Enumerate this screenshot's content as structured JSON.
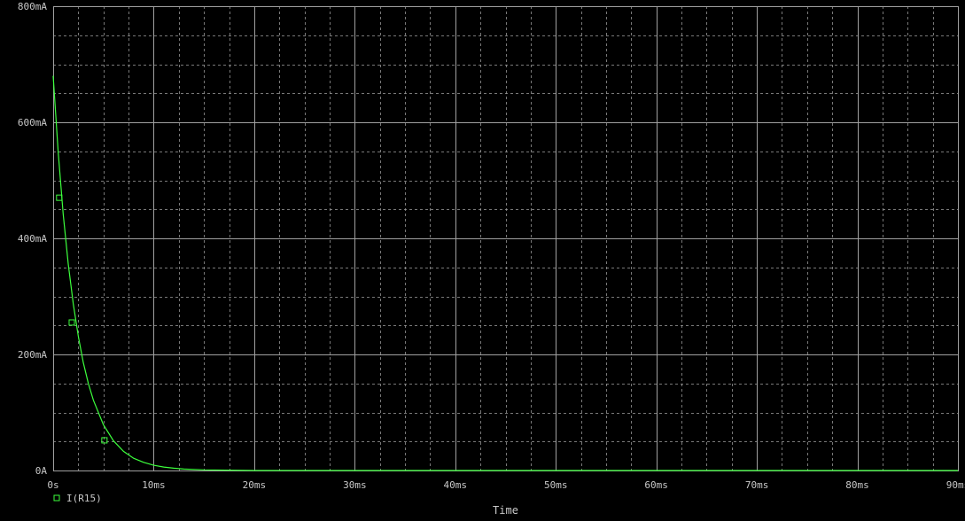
{
  "colors": {
    "background": "#000000",
    "grid": "#a0a0a0",
    "axis_text": "#c8c8c8",
    "trace": "#3cff3c"
  },
  "chart_data": {
    "type": "line",
    "xlabel": "Time",
    "ylabel": "",
    "x_unit": "ms",
    "y_unit": "mA",
    "xlim": [
      0,
      90
    ],
    "ylim": [
      0,
      800
    ],
    "x_ticks": [
      {
        "value": 0,
        "label": "0s"
      },
      {
        "value": 10,
        "label": "10ms"
      },
      {
        "value": 20,
        "label": "20ms"
      },
      {
        "value": 30,
        "label": "30ms"
      },
      {
        "value": 40,
        "label": "40ms"
      },
      {
        "value": 50,
        "label": "50ms"
      },
      {
        "value": 60,
        "label": "60ms"
      },
      {
        "value": 70,
        "label": "70ms"
      },
      {
        "value": 80,
        "label": "80ms"
      },
      {
        "value": 90,
        "label": "90ms"
      }
    ],
    "y_ticks": [
      {
        "value": 0,
        "label": "0A"
      },
      {
        "value": 200,
        "label": "200mA"
      },
      {
        "value": 400,
        "label": "400mA"
      },
      {
        "value": 600,
        "label": "600mA"
      },
      {
        "value": 800,
        "label": "800mA"
      }
    ],
    "grid": true,
    "legend": "bottom-left",
    "series": [
      {
        "name": "I(R15)",
        "marker": "square",
        "x": [
          0,
          0.5,
          1.0,
          1.5,
          2.0,
          2.5,
          3.0,
          3.5,
          4.0,
          5.0,
          6.0,
          7.0,
          8.0,
          9.0,
          10.0,
          11.0,
          12.0,
          13.0,
          15.0,
          20.0,
          30.0,
          40.0,
          50.0,
          60.0,
          70.0,
          80.0,
          90.0
        ],
        "y": [
          680,
          548,
          442,
          356,
          287,
          231,
          186,
          150,
          121,
          79,
          51,
          33,
          21,
          14,
          9,
          6,
          4,
          2.5,
          1,
          0,
          0,
          0,
          0,
          0,
          0,
          0,
          0
        ],
        "marker_points": [
          {
            "x": 0.6,
            "y": 470
          },
          {
            "x": 1.85,
            "y": 255
          },
          {
            "x": 5.1,
            "y": 52
          }
        ]
      }
    ]
  }
}
